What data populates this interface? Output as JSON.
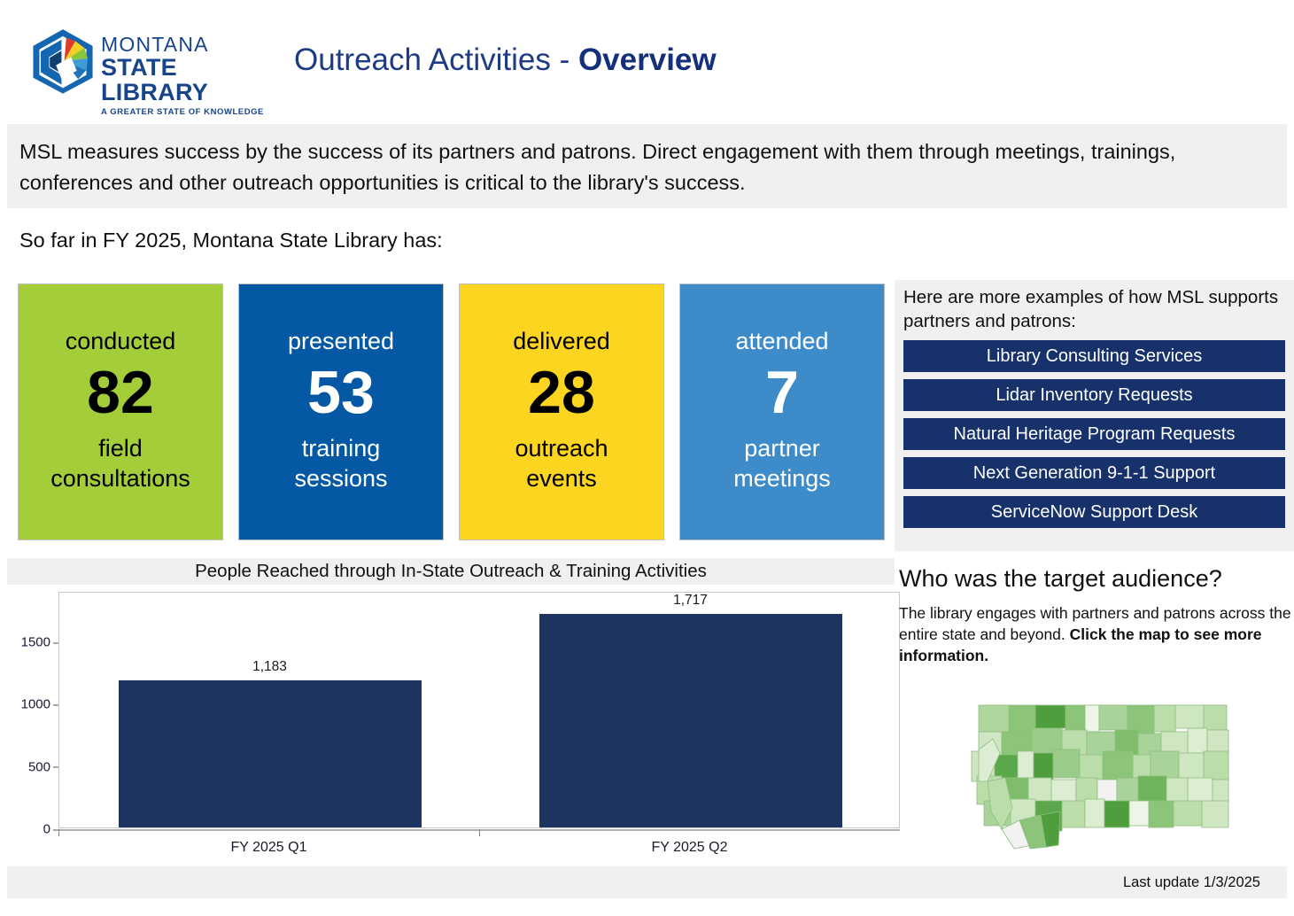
{
  "header": {
    "logo": {
      "line1": "MONTANA",
      "line2": "STATE LIBRARY",
      "tagline": "A GREATER STATE OF KNOWLEDGE"
    },
    "title_plain": "Outreach Activities - ",
    "title_bold": "Overview"
  },
  "intro": {
    "paragraph": "MSL measures success by the success of its partners and patrons.  Direct engagement with them through meetings, trainings, conferences and other outreach opportunities is critical to the library's success.",
    "subheading": "So far in FY 2025, Montana State Library has:"
  },
  "kpis": [
    {
      "verb": "conducted",
      "number": "82",
      "unit": "field\nconsultations",
      "color": "#A3CE39",
      "text_color": "#000000"
    },
    {
      "verb": "presented",
      "number": "53",
      "unit": "training\nsessions",
      "color": "#0458A4",
      "text_color": "#FFFFFF"
    },
    {
      "verb": "delivered",
      "number": "28",
      "unit": "outreach\nevents",
      "color": "#FCD520",
      "text_color": "#000000"
    },
    {
      "verb": "attended",
      "number": "7",
      "unit": "partner\nmeetings",
      "color": "#3E8BCA",
      "text_color": "#FFFFFF"
    }
  ],
  "sidebar": {
    "intro": "Here are more examples of how MSL supports partners and patrons:",
    "buttons": [
      "Library Consulting Services",
      "Lidar Inventory Requests",
      "Natural Heritage Program Requests",
      "Next Generation 9-1-1 Support",
      "ServiceNow Support Desk"
    ],
    "button_color": "#17316B"
  },
  "audience": {
    "heading": "Who was the target audience?",
    "body_plain": "The library engages with partners and patrons across the entire state and beyond. ",
    "body_bold": "Click the map to see more information.",
    "map_name": "montana-county-choropleth"
  },
  "footer": {
    "last_update": "Last update 1/3/2025"
  },
  "chart_data": {
    "type": "bar",
    "title": "People Reached through In-State Outreach & Training Activities",
    "categories": [
      "FY 2025 Q1",
      "FY 2025 Q2"
    ],
    "values": [
      1183,
      1717
    ],
    "value_labels": [
      "1,183",
      "1,717"
    ],
    "xlabel": "",
    "ylabel": "",
    "ylim": [
      0,
      1900
    ],
    "yticks": [
      0,
      500,
      1000,
      1500
    ],
    "ytick_labels": [
      "0",
      "500",
      "1000",
      "1500"
    ],
    "bar_color": "#1D3461",
    "grid": false,
    "legend": false
  }
}
